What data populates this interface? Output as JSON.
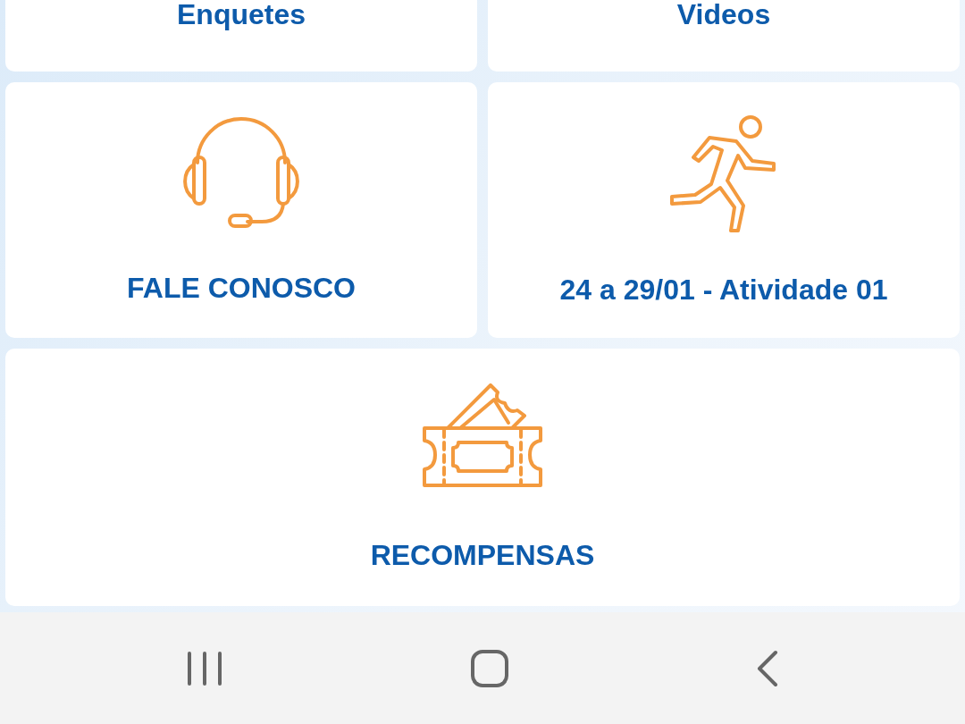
{
  "menu_cards": [
    {
      "label": "Enquetes",
      "kind": "clipped"
    },
    {
      "label": "Videos",
      "kind": "clipped"
    },
    {
      "label": "FALE CONOSCO",
      "kind": "headset"
    },
    {
      "label": "24 a 29/01 - Atividade 01",
      "kind": "runner"
    },
    {
      "label": "RECOMPENSAS",
      "kind": "ticket"
    }
  ]
}
